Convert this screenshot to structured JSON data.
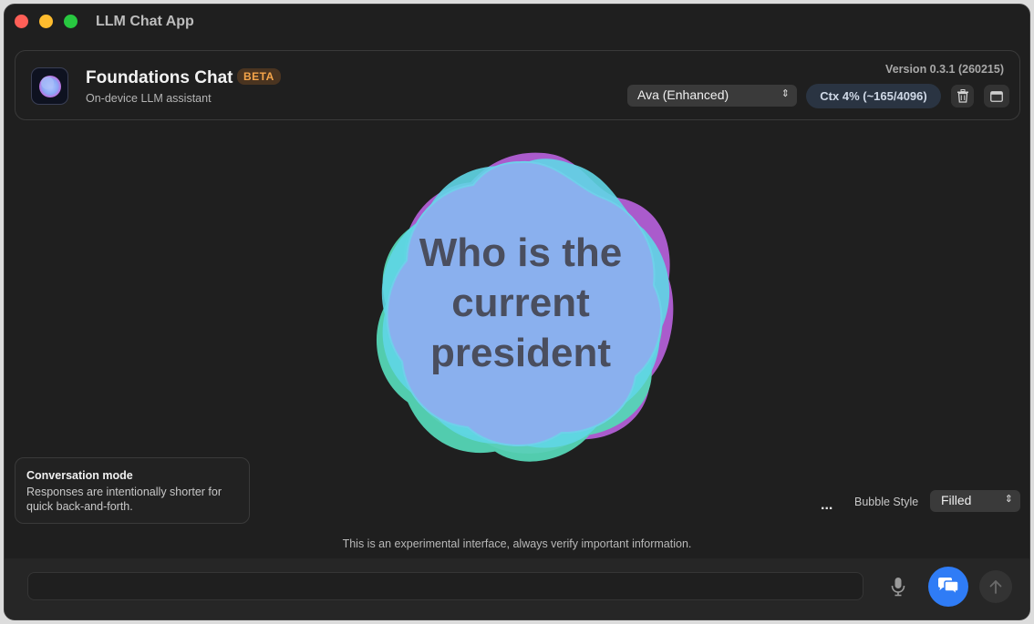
{
  "window": {
    "title": "LLM Chat App"
  },
  "header": {
    "app_name": "Foundations Chat",
    "badge": "BETA",
    "subtitle": "On-device LLM assistant",
    "version": "Version 0.3.1 (260215)",
    "voice_select": {
      "selected": "Ava (Enhanced)"
    },
    "context": "Ctx 4% (~165/4096)",
    "icons": {
      "trash": "trash-icon",
      "sidebar": "sidebar-toggle-icon"
    }
  },
  "bubble": {
    "lines": [
      "Who is the",
      "current",
      "president"
    ],
    "colors": {
      "fill": "#8ab0ee",
      "purple": "#b25fd6",
      "cyan": "#5fd6e6",
      "teal": "#55d6b6"
    }
  },
  "conversation_mode": {
    "title": "Conversation mode",
    "description": "Responses are intentionally shorter for quick back-and-forth."
  },
  "controls": {
    "more_label": "...",
    "bubble_style_label": "Bubble Style",
    "bubble_style_selected": "Filled"
  },
  "disclaimer": "This is an experimental interface, always verify important information.",
  "composer": {
    "placeholder": "",
    "value": "",
    "icons": {
      "mic": "microphone-icon",
      "chat_mode": "chat-bubbles-icon",
      "send": "arrow-up-icon"
    },
    "accent_color": "#2f7cf6"
  }
}
